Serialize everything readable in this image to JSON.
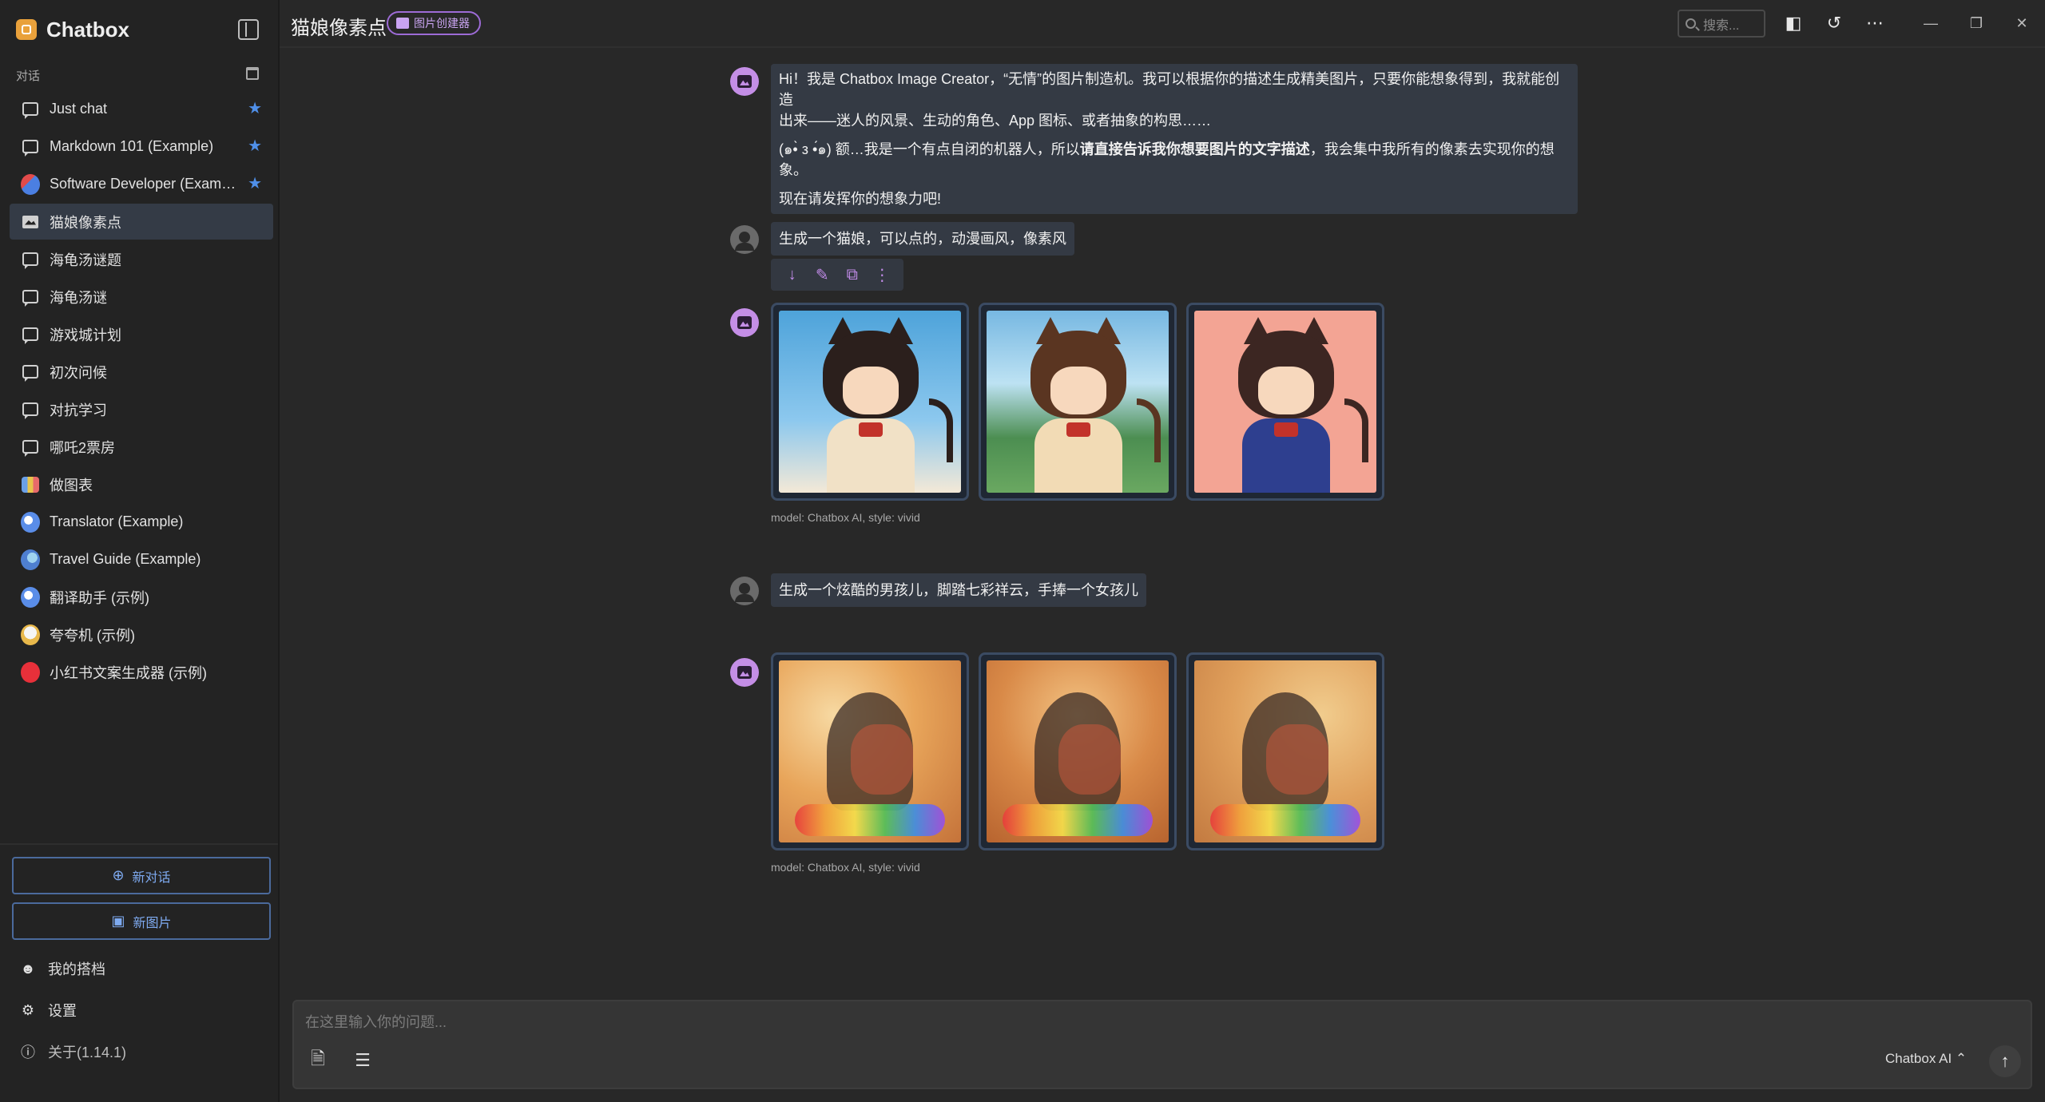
{
  "app": {
    "name": "Chatbox"
  },
  "sidebar": {
    "section_label": "对话",
    "items": [
      {
        "label": "Just chat",
        "icon": "chat-bubble-icon",
        "starred": true
      },
      {
        "label": "Markdown 101 (Example)",
        "icon": "chat-bubble-icon",
        "starred": true
      },
      {
        "label": "Software Developer (Exam…",
        "icon": "avatar-developer-icon",
        "starred": true
      },
      {
        "label": "猫娘像素点",
        "icon": "image-icon",
        "starred": false,
        "active": true
      },
      {
        "label": "海龟汤谜题",
        "icon": "chat-bubble-icon",
        "starred": false
      },
      {
        "label": "海龟汤谜",
        "icon": "chat-bubble-icon",
        "starred": false
      },
      {
        "label": "游戏城计划",
        "icon": "chat-bubble-icon",
        "starred": false
      },
      {
        "label": "初次问候",
        "icon": "chat-bubble-icon",
        "starred": false
      },
      {
        "label": "对抗学习",
        "icon": "chat-bubble-icon",
        "starred": false
      },
      {
        "label": "哪吒2票房",
        "icon": "chat-bubble-icon",
        "starred": false
      },
      {
        "label": "做图表",
        "icon": "avatar-chart-icon",
        "starred": false
      },
      {
        "label": "Translator (Example)",
        "icon": "avatar-translator-icon",
        "starred": false
      },
      {
        "label": "Travel Guide (Example)",
        "icon": "avatar-globe-icon",
        "starred": false
      },
      {
        "label": "翻译助手 (示例)",
        "icon": "avatar-translator-icon",
        "starred": false
      },
      {
        "label": "夸夸机 (示例)",
        "icon": "avatar-duck-icon",
        "starred": false
      },
      {
        "label": "小红书文案生成器 (示例)",
        "icon": "avatar-xiaohongshu-icon",
        "starred": false
      }
    ],
    "new_chat_label": "新对话",
    "new_image_label": "新图片",
    "my_partners_label": "我的搭档",
    "settings_label": "设置",
    "about_label": "关于(1.14.1)"
  },
  "header": {
    "title": "猫娘像素点",
    "badge": "图片创建器",
    "search_placeholder": "搜索..."
  },
  "messages": [
    {
      "role": "assistant",
      "line1": "Hi！我是 Chatbox Image Creator，“无情”的图片制造机。我可以根据你的描述生成精美图片，只要你能想象得到，我就能创造",
      "line2": "出来——迷人的风景、生动的角色、App 图标、或者抽象的构思……",
      "line3_pre": "(๑•̀ з •́๑) 额…我是一个有点自闭的机器人，所以",
      "line3_bold": "请直接告诉我你想要图片的文字描述",
      "line3_post": "，我会集中我所有的像素去实现你的想象。",
      "line4": "现在请发挥你的想象力吧!"
    },
    {
      "role": "user",
      "text": "生成一个猫娘，可以点的，动漫画风，像素风"
    },
    {
      "role": "assistant",
      "caption": "model: Chatbox AI, style: vivid"
    },
    {
      "role": "user",
      "text": "生成一个炫酷的男孩儿，脚踏七彩祥云，手捧一个女孩儿"
    },
    {
      "role": "assistant",
      "caption": "model: Chatbox AI, style: vivid"
    }
  ],
  "composer": {
    "placeholder": "在这里输入你的问题...",
    "model": "Chatbox AI ⌃"
  },
  "colors": {
    "accent_blue": "#4f8fe8",
    "accent_purple": "#c48ee6",
    "bubble": "#343a44"
  }
}
